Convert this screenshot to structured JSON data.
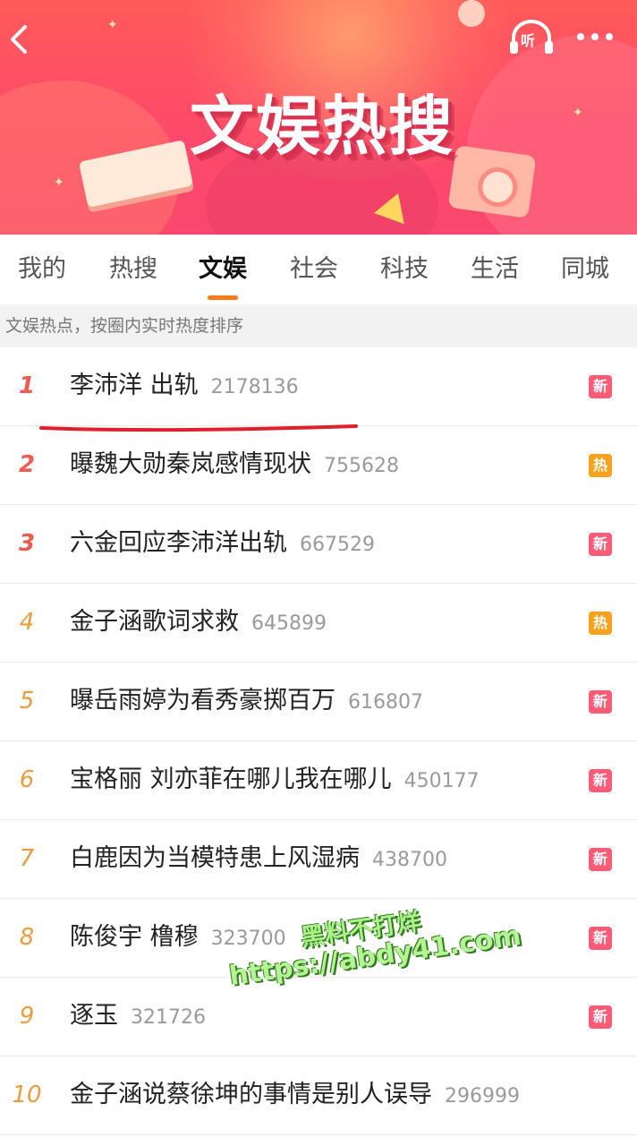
{
  "header": {
    "title": "文娱热搜",
    "listen_label": "听",
    "icons": {
      "back": "back-icon",
      "listen": "headphones-icon",
      "more": "more-icon"
    }
  },
  "tabs": [
    {
      "label": "我的"
    },
    {
      "label": "热搜"
    },
    {
      "label": "文娱",
      "active": true
    },
    {
      "label": "社会"
    },
    {
      "label": "科技"
    },
    {
      "label": "生活"
    },
    {
      "label": "同城"
    }
  ],
  "subtitle": "文娱热点，按圈内实时热度排序",
  "items": [
    {
      "rank": "1",
      "title": "李沛洋 出轨",
      "count": "2178136",
      "badge": "新"
    },
    {
      "rank": "2",
      "title": "曝魏大勋秦岚感情现状",
      "count": "755628",
      "badge": "热"
    },
    {
      "rank": "3",
      "title": "六金回应李沛洋出轨",
      "count": "667529",
      "badge": "新"
    },
    {
      "rank": "4",
      "title": "金子涵歌词求救",
      "count": "645899",
      "badge": "热"
    },
    {
      "rank": "5",
      "title": "曝岳雨婷为看秀豪掷百万",
      "count": "616807",
      "badge": "新"
    },
    {
      "rank": "6",
      "title": "宝格丽 刘亦菲在哪儿我在哪儿",
      "count": "450177",
      "badge": "新"
    },
    {
      "rank": "7",
      "title": "白鹿因为当模特患上风湿病",
      "count": "438700",
      "badge": "新"
    },
    {
      "rank": "8",
      "title": "陈俊宇 橹穆",
      "count": "323700",
      "badge": "新"
    },
    {
      "rank": "9",
      "title": "逐玉",
      "count": "321726",
      "badge": "新"
    },
    {
      "rank": "10",
      "title": "金子涵说蔡徐坤的事情是别人误导",
      "count": "296999",
      "badge": ""
    }
  ],
  "watermark": {
    "line1": "黑料不打烊",
    "line2": "https://abdy41.com"
  },
  "colors": {
    "accent": "#ff7a1a",
    "banner": "#fe4a6a",
    "rank_top": "#f05a4f",
    "rank_rest": "#f29a3b",
    "badge_new": "#ff5b77",
    "badge_hot": "#f9a11b",
    "annotation": "#e0202a"
  }
}
